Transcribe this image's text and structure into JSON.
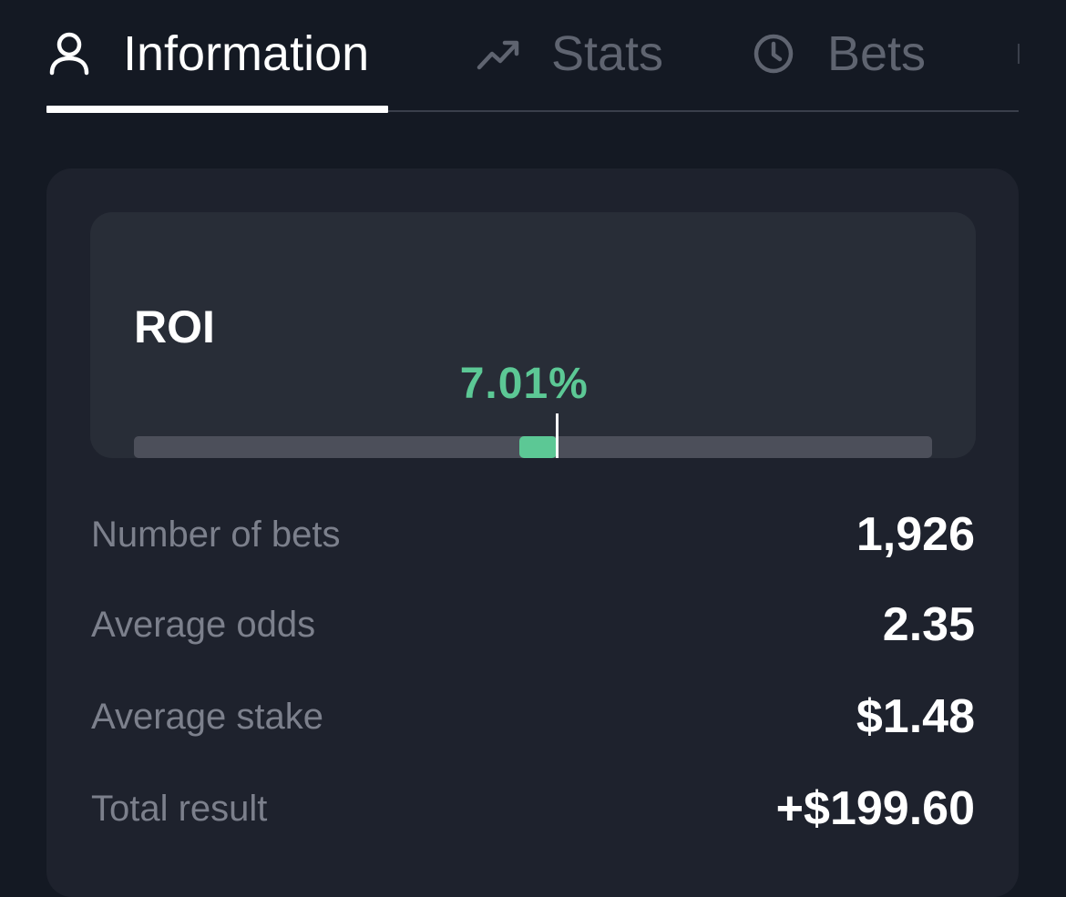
{
  "tabs": [
    {
      "label": "Information",
      "icon": "user-icon",
      "active": true
    },
    {
      "label": "Stats",
      "icon": "trending-up-icon",
      "active": false
    },
    {
      "label": "Bets",
      "icon": "clock-icon",
      "active": false
    }
  ],
  "roi": {
    "title": "ROI",
    "value_text": "7.01%",
    "marker_fraction": 0.53,
    "fill_start_fraction": 0.5,
    "accent_color": "#5cc895"
  },
  "stats": [
    {
      "label": "Number of bets",
      "value": "1,926"
    },
    {
      "label": "Average odds",
      "value": "2.35"
    },
    {
      "label": "Average stake",
      "value": "$1.48"
    },
    {
      "label": "Total result",
      "value": "+$199.60"
    }
  ]
}
